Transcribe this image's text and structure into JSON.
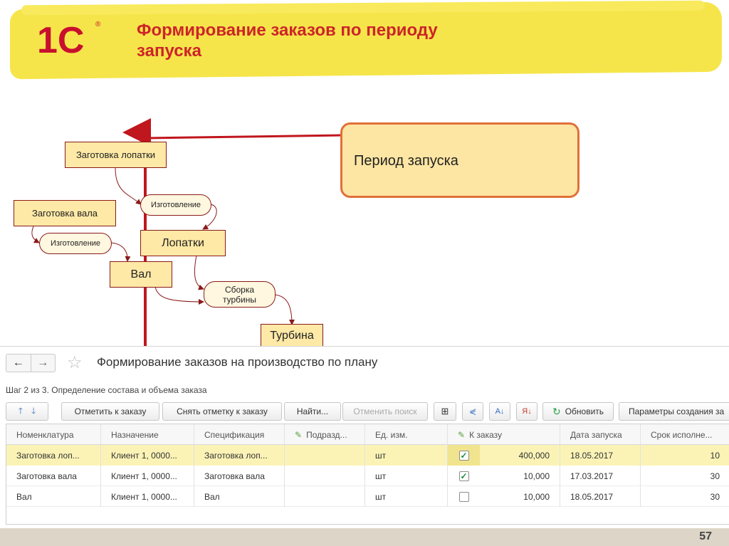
{
  "header": {
    "title": "Формирование заказов по периоду\nзапуска",
    "logo": "1С",
    "logo_mark": "®"
  },
  "diagram": {
    "nodes": {
      "blade_blank": "Заготовка лопатки",
      "manufacture_1": "Изготовление",
      "shaft_blank": "Заготовка вала",
      "manufacture_2": "Изготовление",
      "blades": "Лопатки",
      "shaft": "Вал",
      "assembly": "Сборка\nтурбины",
      "turbine": "Турбина"
    },
    "callout": "Период запуска"
  },
  "window": {
    "nav_back": "←",
    "nav_forward": "→",
    "favorite": "☆",
    "title": "Формирование заказов на производство по плану",
    "step": "Шаг 2 из 3. Определение состава и объема заказа",
    "toolbar": {
      "up": "🡑",
      "down": "🡓",
      "mark": "Отметить к заказу",
      "unmark": "Снять отметку к заказу",
      "find": "Найти...",
      "cancel_search": "Отменить поиск",
      "refresh": "Обновить",
      "params": "Параметры создания за"
    },
    "columns": [
      "Номенклатура",
      "Назначение",
      "Спецификация",
      "Подразд...",
      "Ед. изм.",
      "К заказу",
      "Дата запуска",
      "Срок исполне..."
    ],
    "rows": [
      {
        "item": "Заготовка лоп...",
        "purpose": "Клиент 1, 0000...",
        "spec": "Заготовка лоп...",
        "dept": "",
        "unit": "шт",
        "checked": true,
        "qty": "400,000",
        "date": "18.05.2017",
        "term": "10"
      },
      {
        "item": "Заготовка вала",
        "purpose": "Клиент 1, 0000...",
        "spec": "Заготовка вала",
        "dept": "",
        "unit": "шт",
        "checked": true,
        "qty": "10,000",
        "date": "17.03.2017",
        "term": "30"
      },
      {
        "item": "Вал",
        "purpose": "Клиент 1, 0000...",
        "spec": "Вал",
        "dept": "",
        "unit": "шт",
        "checked": false,
        "qty": "10,000",
        "date": "18.05.2017",
        "term": "30"
      }
    ]
  },
  "page_number": "57",
  "colors": {
    "banner": "#f6e54a",
    "title": "#cc2529",
    "node_fill": "#fee9a6",
    "node_border": "#8a1a1a",
    "period_line": "#c0161d",
    "callout_border": "#e0703a",
    "selected_row": "#fbf3b6"
  }
}
